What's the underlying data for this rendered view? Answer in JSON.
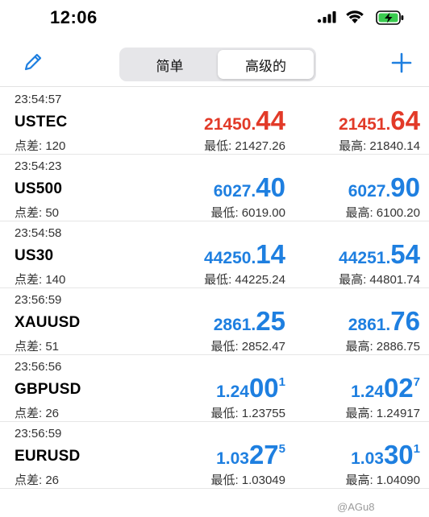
{
  "status_bar": {
    "time": "12:06",
    "icons": [
      "signal-icon",
      "wifi-icon",
      "battery-charging-icon"
    ]
  },
  "toolbar": {
    "edit_icon": "pencil-icon",
    "tabs": [
      {
        "label": "简单",
        "selected": false
      },
      {
        "label": "高级的",
        "selected": true
      }
    ],
    "add_icon": "plus-icon"
  },
  "colors": {
    "accent": "#1e7fe0",
    "down": "#e23a28",
    "text": "#000000",
    "secondary_text": "#333333",
    "separator": "#e6e6e6"
  },
  "quotes": [
    {
      "time": "23:54:57",
      "symbol": "USTEC",
      "spread": "点差: 120",
      "direction": "red",
      "bid": {
        "main": "21450.",
        "big": "44",
        "sup": ""
      },
      "ask": {
        "main": "21451.",
        "big": "64",
        "sup": ""
      },
      "low": "最低: 21427.26",
      "high": "最高: 21840.14"
    },
    {
      "time": "23:54:23",
      "symbol": "US500",
      "spread": "点差: 50",
      "direction": "blue",
      "bid": {
        "main": "6027.",
        "big": "40",
        "sup": ""
      },
      "ask": {
        "main": "6027.",
        "big": "90",
        "sup": ""
      },
      "low": "最低: 6019.00",
      "high": "最高: 6100.20"
    },
    {
      "time": "23:54:58",
      "symbol": "US30",
      "spread": "点差: 140",
      "direction": "blue",
      "bid": {
        "main": "44250.",
        "big": "14",
        "sup": ""
      },
      "ask": {
        "main": "44251.",
        "big": "54",
        "sup": ""
      },
      "low": "最低: 44225.24",
      "high": "最高: 44801.74"
    },
    {
      "time": "23:56:59",
      "symbol": "XAUUSD",
      "spread": "点差: 51",
      "direction": "blue",
      "bid": {
        "main": "2861.",
        "big": "25",
        "sup": ""
      },
      "ask": {
        "main": "2861.",
        "big": "76",
        "sup": ""
      },
      "low": "最低: 2852.47",
      "high": "最高: 2886.75"
    },
    {
      "time": "23:56:56",
      "symbol": "GBPUSD",
      "spread": "点差: 26",
      "direction": "blue",
      "bid": {
        "main": "1.24",
        "big": "00",
        "sup": "1"
      },
      "ask": {
        "main": "1.24",
        "big": "02",
        "sup": "7"
      },
      "low": "最低: 1.23755",
      "high": "最高: 1.24917"
    },
    {
      "time": "23:56:59",
      "symbol": "EURUSD",
      "spread": "点差: 26",
      "direction": "blue",
      "bid": {
        "main": "1.03",
        "big": "27",
        "sup": "5"
      },
      "ask": {
        "main": "1.03",
        "big": "30",
        "sup": "1"
      },
      "low": "最低: 1.03049",
      "high": "最高: 1.04090"
    }
  ],
  "watermark": "@AGu8"
}
